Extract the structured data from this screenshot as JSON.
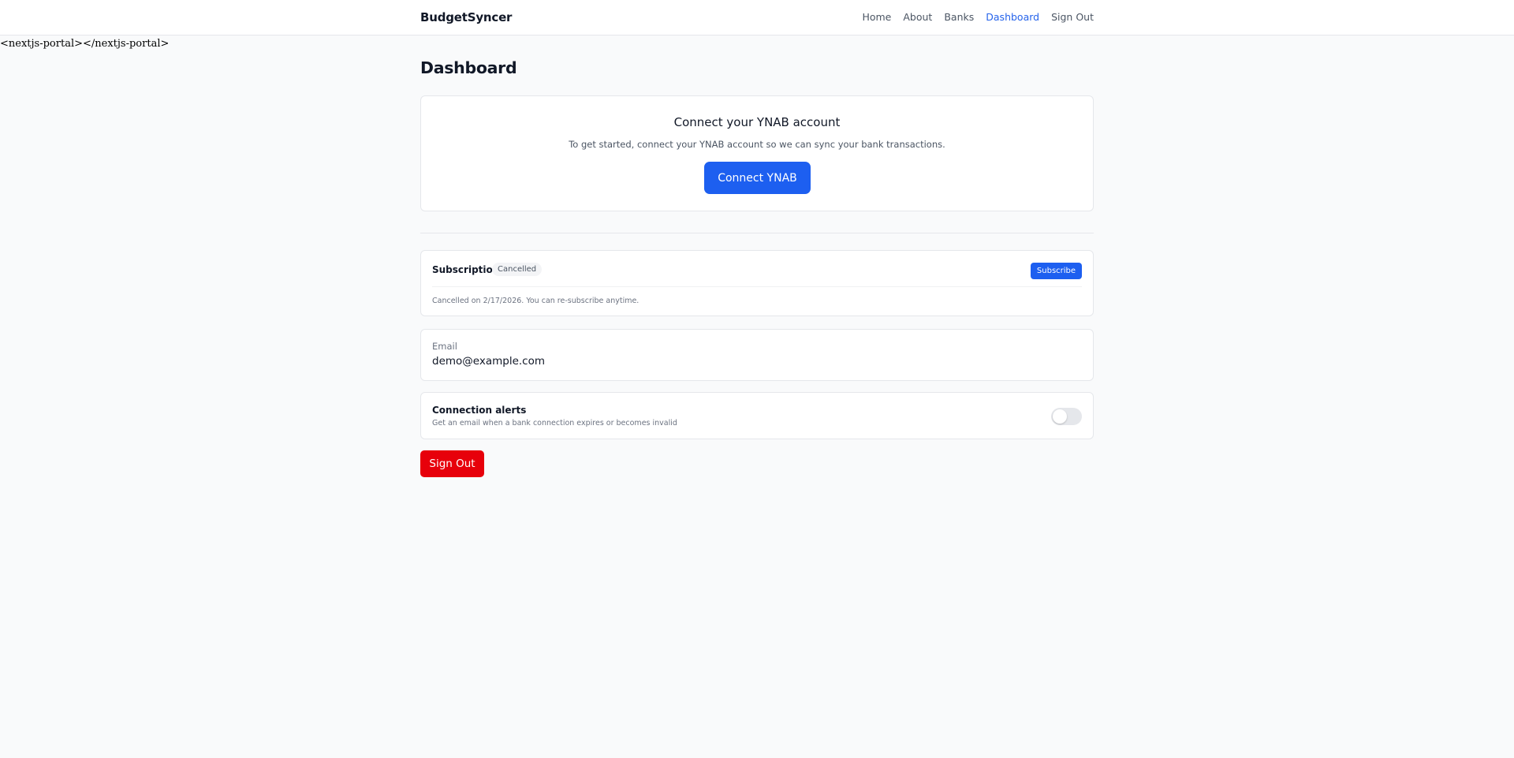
{
  "navbar": {
    "brand": "BudgetSyncer",
    "links": [
      {
        "label": "Home",
        "active": false
      },
      {
        "label": "About",
        "active": false
      },
      {
        "label": "Banks",
        "active": false
      },
      {
        "label": "Dashboard",
        "active": true
      },
      {
        "label": "Sign Out",
        "active": false
      }
    ]
  },
  "portal_text": "<nextjs-portal></nextjs-portal>",
  "page_title": "Dashboard",
  "ynab": {
    "title": "Connect your YNAB account",
    "description": "To get started, connect your YNAB account so we can sync your bank transactions.",
    "button_label": "Connect YNAB"
  },
  "subscription": {
    "label": "Subscription",
    "status": "Cancelled",
    "button_label": "Subscribe",
    "note": "Cancelled on 2/17/2026. You can re-subscribe anytime."
  },
  "email": {
    "label": "Email",
    "value": "demo@example.com"
  },
  "alerts": {
    "title": "Connection alerts",
    "description": "Get an email when a bank connection expires or becomes invalid",
    "enabled": false
  },
  "sign_out_label": "Sign Out",
  "colors": {
    "accent": "#1d5ff0",
    "active_link": "#2563eb",
    "danger": "#e7000b",
    "background": "#f9fafb"
  }
}
